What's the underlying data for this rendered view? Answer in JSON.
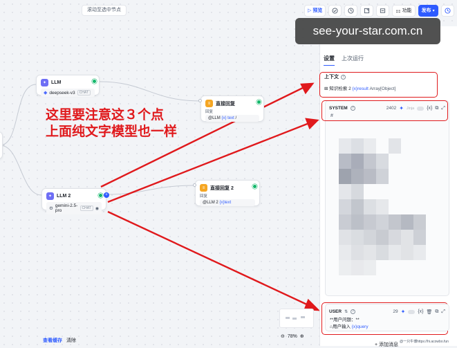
{
  "canvas": {
    "scroll_to_selected": "滚动至选中节点"
  },
  "toolbar": {
    "preview": "预览",
    "features": "功能",
    "publish": "发布"
  },
  "nodes": {
    "llm1": {
      "title": "LLM",
      "model": "deepseek-v3",
      "mode": "CHAT"
    },
    "reply1": {
      "title": "直接回复",
      "out_label": "回复",
      "out_prefix": "@LLM",
      "out_var": "{x} text",
      "out_suffix": "/"
    },
    "llm2": {
      "title": "LLM 2",
      "model": "gemini-2.5-pro",
      "mode": "CHAT"
    },
    "reply2": {
      "title": "直接回复 2",
      "out_label": "回复",
      "out_prefix": "@LLM 2",
      "out_var": "{x}text"
    }
  },
  "annotation": {
    "line1": "这里要注意这３个点",
    "line2": "上面纯文字模型也一样"
  },
  "panel": {
    "tabs": [
      "设置",
      "上次运行"
    ],
    "context": {
      "title": "上下文",
      "value_node": "知识检索 2",
      "value_var": "{x}result",
      "value_type": "Array[Object]"
    },
    "system": {
      "label": "SYSTEM",
      "count": "2402",
      "jinja": "Jinja",
      "braces": "{x}"
    },
    "user": {
      "label": "USER",
      "count": "29",
      "braces": "{x}",
      "line1": "**用户问题：**",
      "line2_prefix": "用户输入",
      "line2_var": "{x}query"
    },
    "add_message": "+ 添加消息"
  },
  "bottom": {
    "view_cache": "查看缓存",
    "clear": "清除",
    "zoom": "78%"
  },
  "watermark": {
    "text": "see-your-star.com.cn",
    "footer": "@一只牛博https://hi.acowbo.fun"
  },
  "colors": {
    "accent": "#2e5bff",
    "annotation": "#e0191c",
    "success": "#12b76a",
    "reply_icon": "#f5a623",
    "llm_icon": "#6e6ef5"
  }
}
